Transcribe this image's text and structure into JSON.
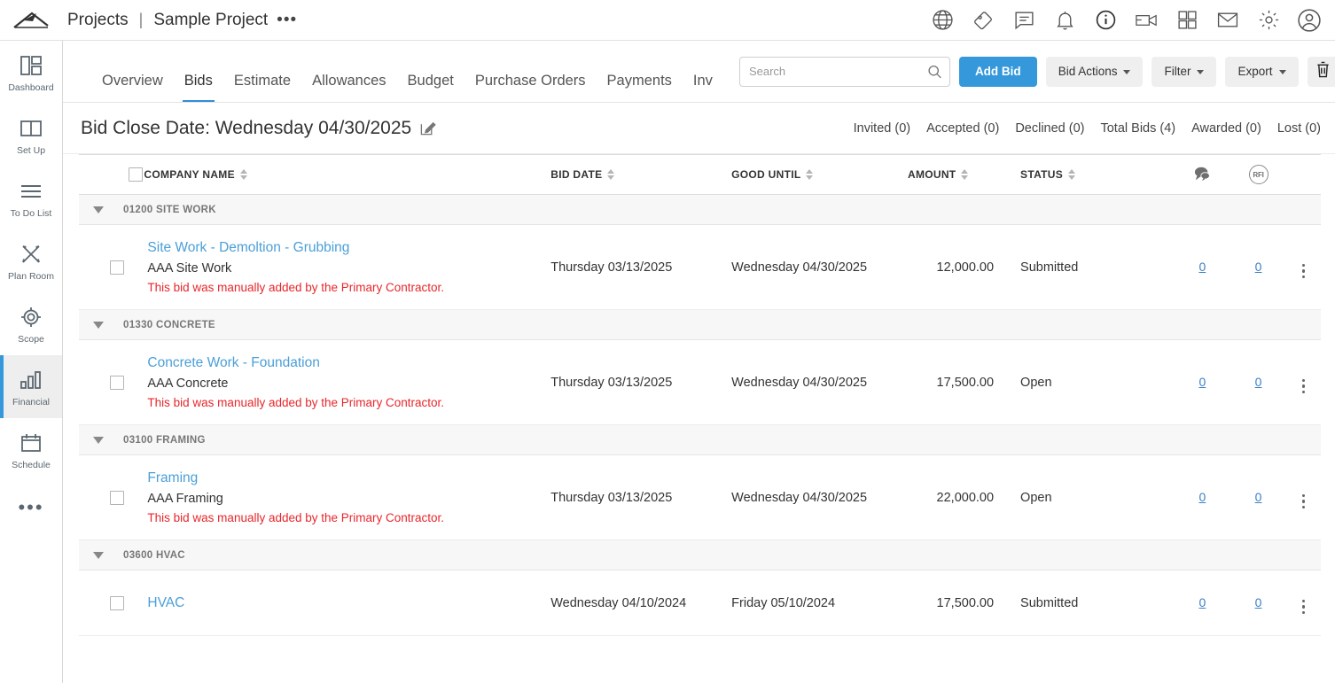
{
  "topbar": {
    "breadcrumb_projects": "Projects",
    "breadcrumb_separator": "|",
    "breadcrumb_project": "Sample Project",
    "breadcrumb_more": "•••",
    "icons": [
      "globe-icon",
      "tag-icon",
      "chat-icon",
      "bell-icon",
      "info-icon",
      "video-icon",
      "grid-icon",
      "mail-icon",
      "gear-icon",
      "user-avatar-icon"
    ]
  },
  "sidebar": {
    "items": [
      {
        "label": "Dashboard",
        "icon": "dashboard-icon",
        "active": false
      },
      {
        "label": "Set Up",
        "icon": "book-icon",
        "active": false
      },
      {
        "label": "To Do List",
        "icon": "list-icon",
        "active": false
      },
      {
        "label": "Plan Room",
        "icon": "tools-icon",
        "active": false
      },
      {
        "label": "Scope",
        "icon": "target-icon",
        "active": false
      },
      {
        "label": "Financial",
        "icon": "bar-chart-icon",
        "active": true
      },
      {
        "label": "Schedule",
        "icon": "calendar-icon",
        "active": false
      }
    ],
    "more": "•••"
  },
  "tabs": [
    {
      "label": "Overview",
      "active": false
    },
    {
      "label": "Bids",
      "active": true
    },
    {
      "label": "Estimate",
      "active": false
    },
    {
      "label": "Allowances",
      "active": false
    },
    {
      "label": "Budget",
      "active": false
    },
    {
      "label": "Purchase Orders",
      "active": false
    },
    {
      "label": "Payments",
      "active": false
    },
    {
      "label": "Inv",
      "active": false
    }
  ],
  "toolbar": {
    "search_placeholder": "Search",
    "search_value": "",
    "add_bid": "Add Bid",
    "bid_actions": "Bid Actions",
    "filter": "Filter",
    "export": "Export",
    "delete_icon": "trash-icon",
    "help_label": "?"
  },
  "bidbar": {
    "close_date_label": "Bid Close Date: Wednesday 04/30/2025",
    "edit_icon": "edit-pencil-icon",
    "stats": [
      "Invited (0)",
      "Accepted (0)",
      "Declined (0)",
      "Total Bids (4)",
      "Awarded (0)",
      "Lost (0)"
    ]
  },
  "table": {
    "columns": [
      {
        "key": "company",
        "label": "COMPANY NAME",
        "sortable": true
      },
      {
        "key": "bid_date",
        "label": "BID DATE",
        "sortable": true
      },
      {
        "key": "good_until",
        "label": "GOOD UNTIL",
        "sortable": true
      },
      {
        "key": "amount",
        "label": "AMOUNT",
        "sortable": true
      },
      {
        "key": "status",
        "label": "STATUS",
        "sortable": true
      },
      {
        "key": "comments",
        "label": "chat-bubble-icon",
        "sortable": false
      },
      {
        "key": "rfi",
        "label": "RFI",
        "sortable": false
      }
    ],
    "groups": [
      {
        "code_label": "01200 SITE WORK",
        "rows": [
          {
            "title": "Site Work - Demoltion - Grubbing",
            "company": "AAA Site Work",
            "note": "This bid was manually added by the Primary Contractor.",
            "bid_date": "Thursday 03/13/2025",
            "good_until": "Wednesday 04/30/2025",
            "amount": "12,000.00",
            "status": "Submitted",
            "comments": "0",
            "rfi": "0"
          }
        ]
      },
      {
        "code_label": "01330 CONCRETE",
        "rows": [
          {
            "title": "Concrete Work - Foundation",
            "company": "AAA Concrete",
            "note": "This bid was manually added by the Primary Contractor.",
            "bid_date": "Thursday 03/13/2025",
            "good_until": "Wednesday 04/30/2025",
            "amount": "17,500.00",
            "status": "Open",
            "comments": "0",
            "rfi": "0"
          }
        ]
      },
      {
        "code_label": "03100 FRAMING",
        "rows": [
          {
            "title": "Framing",
            "company": "AAA Framing",
            "note": "This bid was manually added by the Primary Contractor.",
            "bid_date": "Thursday 03/13/2025",
            "good_until": "Wednesday 04/30/2025",
            "amount": "22,000.00",
            "status": "Open",
            "comments": "0",
            "rfi": "0"
          }
        ]
      },
      {
        "code_label": "03600 HVAC",
        "rows": [
          {
            "title": "HVAC",
            "company": "",
            "note": "",
            "bid_date": "Wednesday 04/10/2024",
            "good_until": "Friday 05/10/2024",
            "amount": "17,500.00",
            "status": "Submitted",
            "comments": "0",
            "rfi": "0"
          }
        ]
      }
    ]
  },
  "colors": {
    "accent_blue": "#3498db",
    "link_blue": "#4a9fd8",
    "note_red": "#e8262b",
    "group_bg": "#f7f7f7"
  }
}
